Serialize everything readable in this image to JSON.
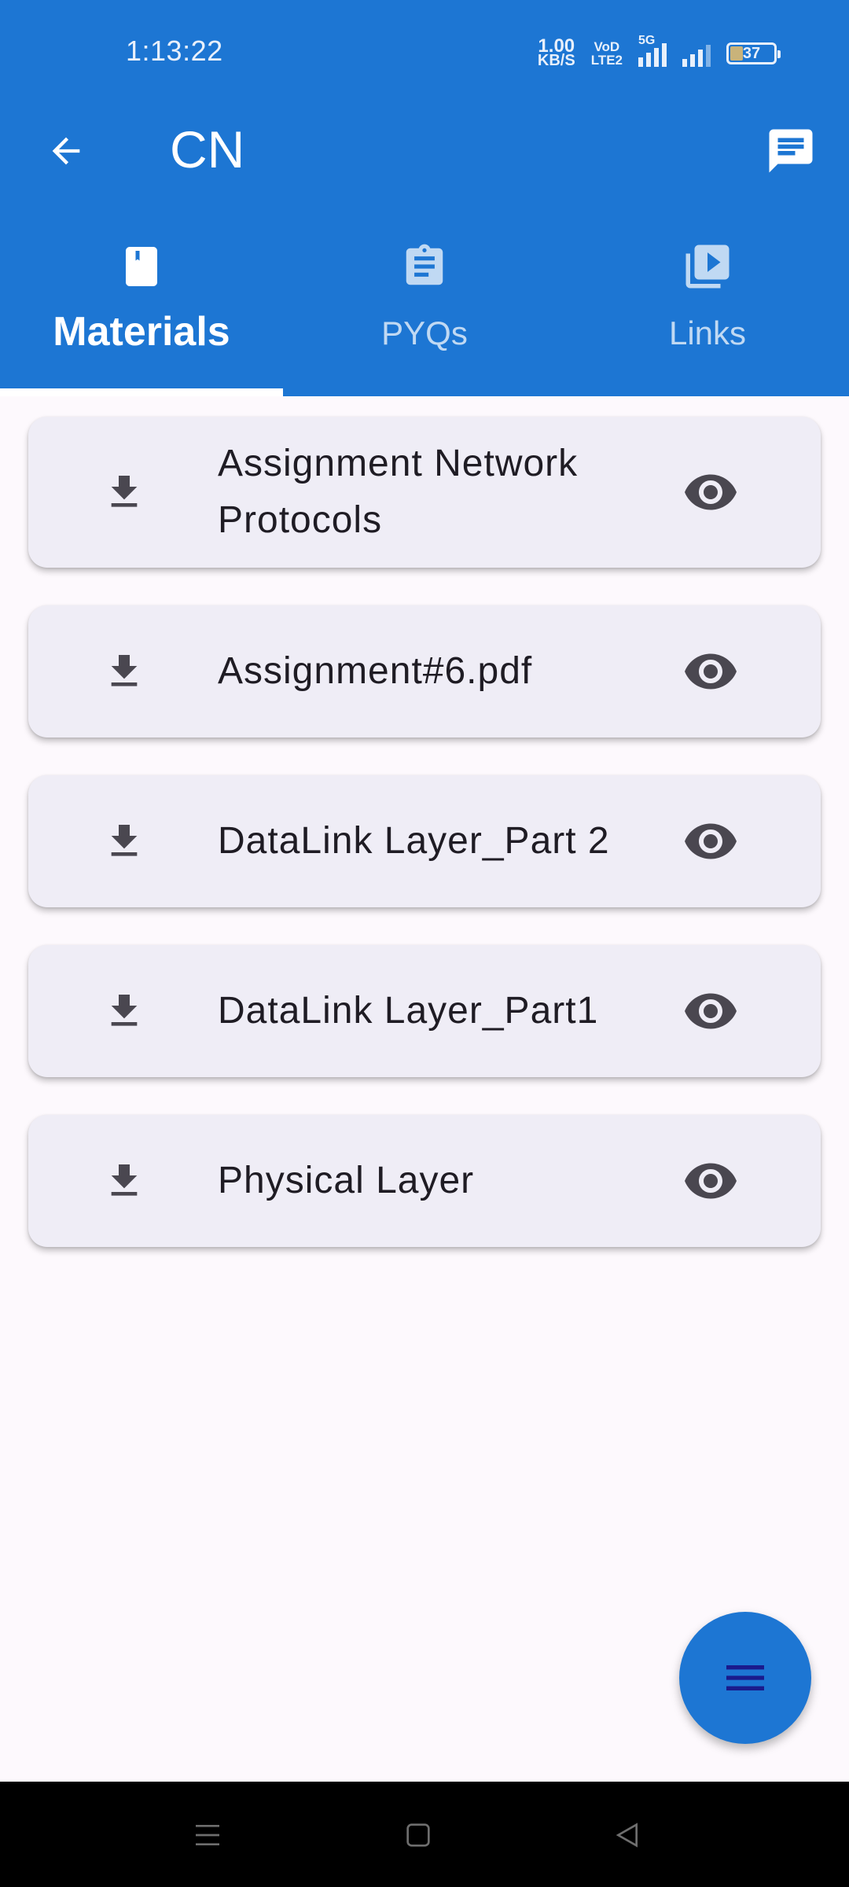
{
  "status_bar": {
    "time": "1:13:22",
    "speed_value": "1.00",
    "speed_unit": "KB/S",
    "volte_top": "VoD",
    "volte_bottom": "LTE2",
    "network": "5G",
    "battery": "37"
  },
  "app_bar": {
    "title": "CN",
    "back_icon": "arrow-back-icon",
    "chat_icon": "chat-icon"
  },
  "tabs": [
    {
      "label": "Materials",
      "icon": "book-icon",
      "active": true
    },
    {
      "label": "PYQs",
      "icon": "clipboard-icon",
      "active": false
    },
    {
      "label": "Links",
      "icon": "video-library-icon",
      "active": false
    }
  ],
  "materials": [
    {
      "title": "Assignment Network Protocols"
    },
    {
      "title": "Assignment#6.pdf"
    },
    {
      "title": "DataLink Layer_Part 2"
    },
    {
      "title": "DataLink Layer_Part1"
    },
    {
      "title": "Physical Layer"
    }
  ],
  "fab": {
    "icon": "menu-icon"
  },
  "colors": {
    "primary": "#1d76d3",
    "card": "#efedf6",
    "background": "#fdf9fd",
    "icon_dark": "#4a4750",
    "fab_icon": "#1a1a8c"
  }
}
